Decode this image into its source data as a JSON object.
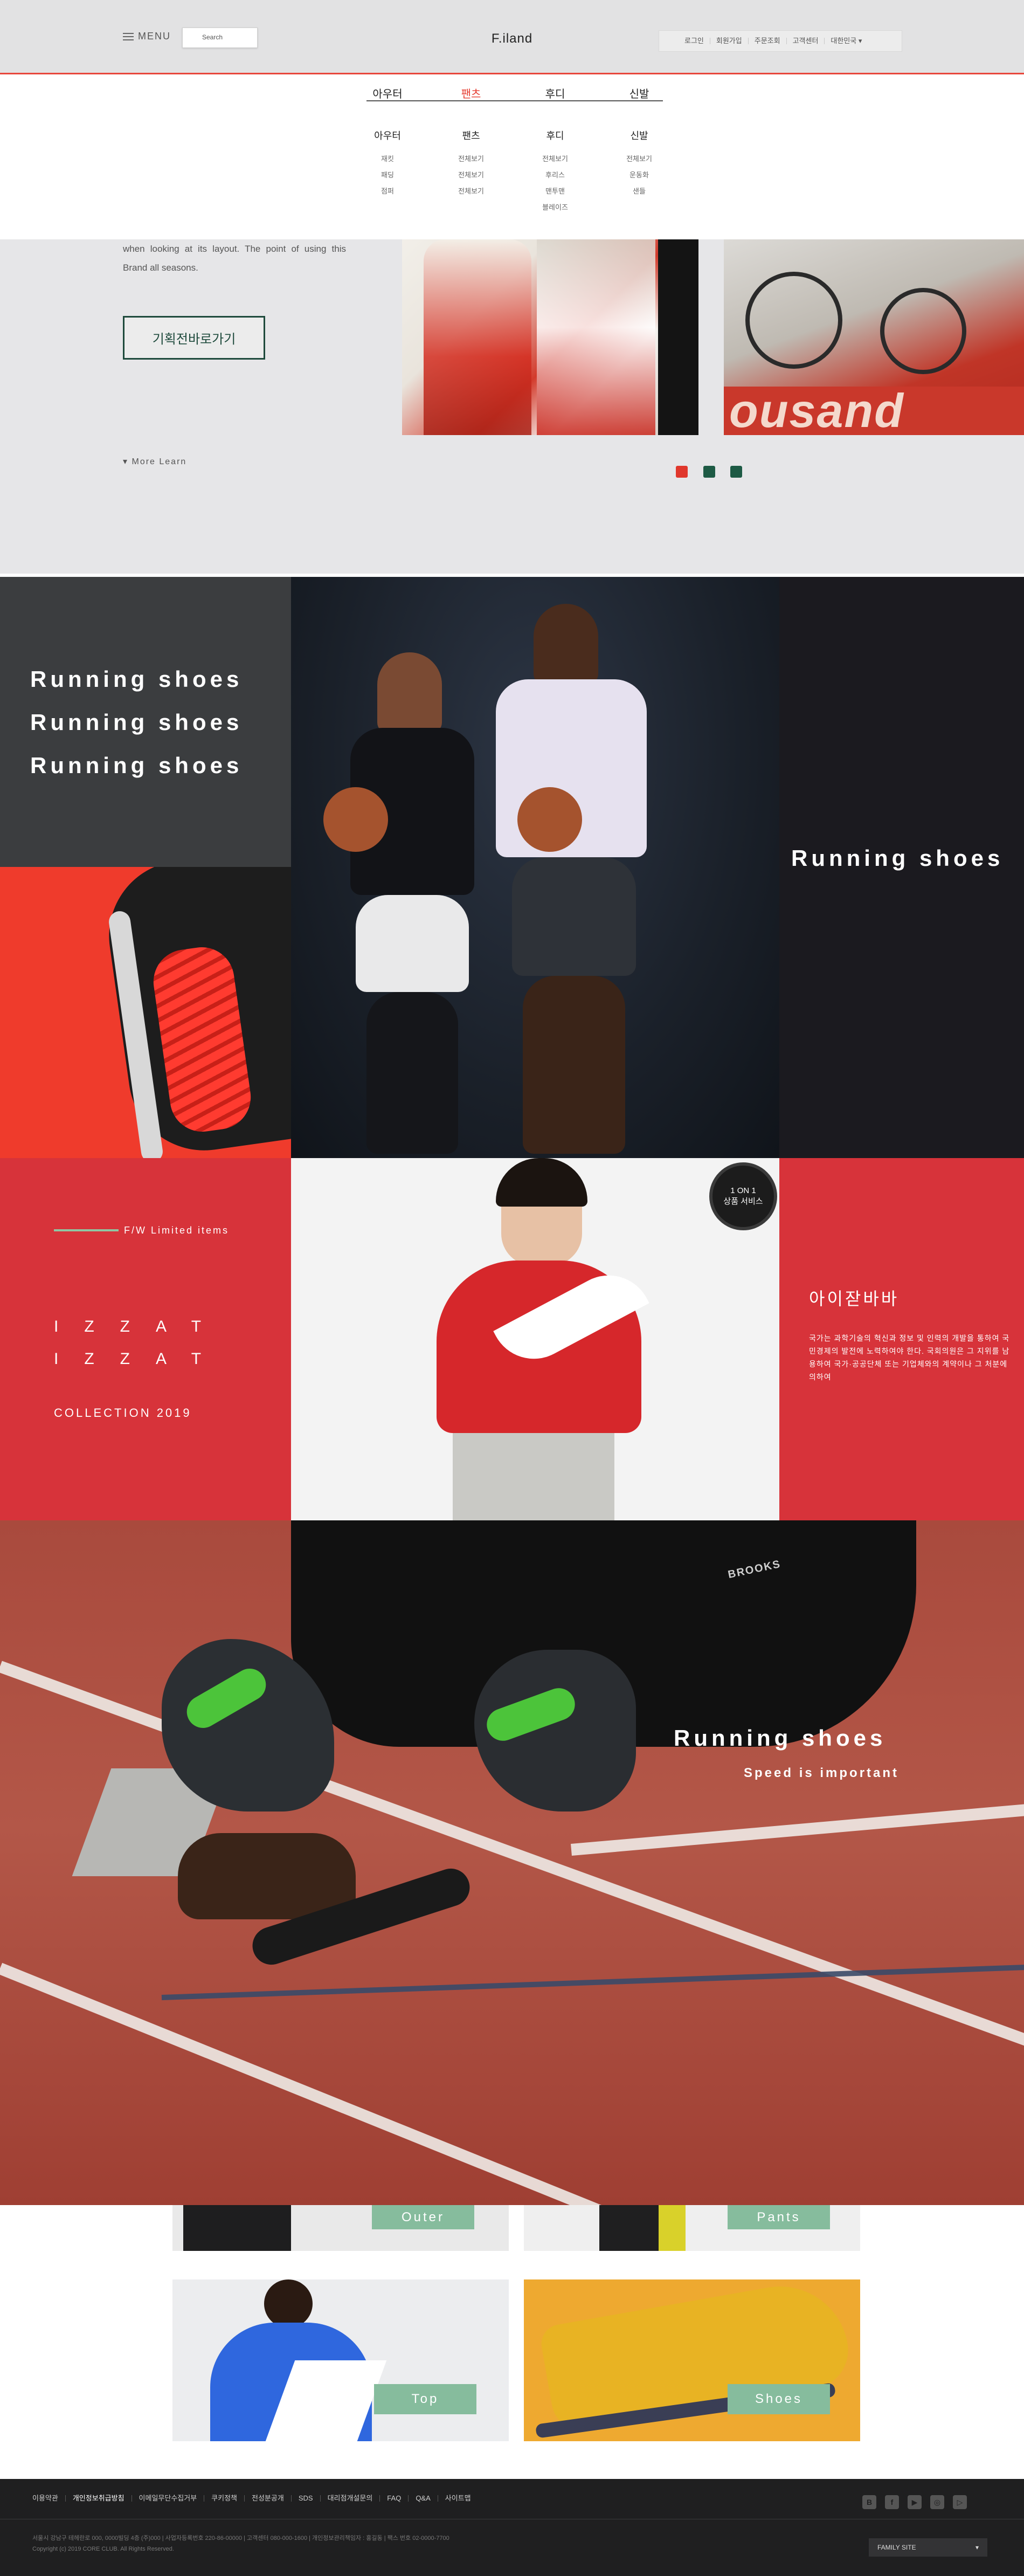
{
  "header": {
    "menu_label": "MENU",
    "search_placeholder": "Search",
    "logo": "F.iland",
    "util_links": [
      "로그인",
      "회원가입",
      "주문조회",
      "고객센터",
      "대한민국 ▾"
    ]
  },
  "mega_menu": {
    "tabs": [
      {
        "label": "아우터",
        "active": false
      },
      {
        "label": "팬츠",
        "active": true
      },
      {
        "label": "후디",
        "active": false
      },
      {
        "label": "신발",
        "active": false
      }
    ],
    "columns": [
      {
        "title": "아우터",
        "items": [
          "재킷",
          "패딩",
          "점퍼"
        ]
      },
      {
        "title": "팬츠",
        "items": [
          "전체보기",
          "전체보기",
          "전체보기"
        ]
      },
      {
        "title": "후디",
        "items": [
          "전체보기",
          "후리스",
          "맨투맨",
          "블레이즈"
        ]
      },
      {
        "title": "신발",
        "items": [
          "전체보기",
          "운동화",
          "샌들"
        ]
      }
    ]
  },
  "hero": {
    "text": "when looking at its layout. The point of using this Brand all seasons.",
    "cta": "기획전바로가기",
    "more": "More Learn",
    "photo_banner": "ousand",
    "dots": [
      "#e0372c",
      "#1d5a44",
      "#1d5a44"
    ]
  },
  "grid": {
    "left_lines": [
      "Running shoes",
      "Running shoes",
      "Running shoes"
    ],
    "right_text": "Running shoes",
    "limited_label": "F/W Limited items",
    "izzat": [
      "IZZAT",
      "IZZAT"
    ],
    "collection": "COLLECTION 2019",
    "badge_top": "1 ON 1",
    "badge_bottom": "상품 서비스",
    "brand_title": "아이잗바바",
    "brand_desc": "국가는 과학기술의 혁신과 정보 및 인력의 개발을 통하여 국민경제의 발전에 노력하여야 한다. 국회의원은 그 지위를 남용하여 국가·공공단체 또는 기업체와의 계약이나 그 처분에 의하여"
  },
  "track": {
    "title": "Running shoes",
    "subtitle": "Speed is important",
    "brand_mark": "BROOKS"
  },
  "categories": [
    {
      "label": "Outer",
      "bg": "#e9e9e9"
    },
    {
      "label": "Pants",
      "bg": "#efefef"
    },
    {
      "label": "Top",
      "bg": "#ecedef"
    },
    {
      "label": "Shoes",
      "bg": "#eea930"
    }
  ],
  "footer": {
    "links": [
      "이용약관",
      "개인정보취급방침",
      "이메일무단수집거부",
      "쿠키정책",
      "전성분공개",
      "SDS",
      "대리점개설문의",
      "FAQ",
      "Q&A",
      "사이트맵"
    ],
    "social_icons": [
      "blog-icon",
      "facebook-icon",
      "youtube-icon",
      "instagram-icon",
      "play-icon"
    ],
    "social_glyphs": [
      "B",
      "f",
      "▶",
      "◎",
      "▷"
    ],
    "company_line1": "서울시 강남구 테헤란로 000, 0000빌딩 4층 (주)000 | 사업자등록번호 220-86-00000 | 고객센터 080-000-1600 | 개인정보관리책임자 : 홍길동 | 팩스 번호 02-0000-7700",
    "company_line2": "Copyright (c) 2019 CORE CLUB. All Rights Reserved.",
    "family_site": "FAMILY SITE"
  }
}
